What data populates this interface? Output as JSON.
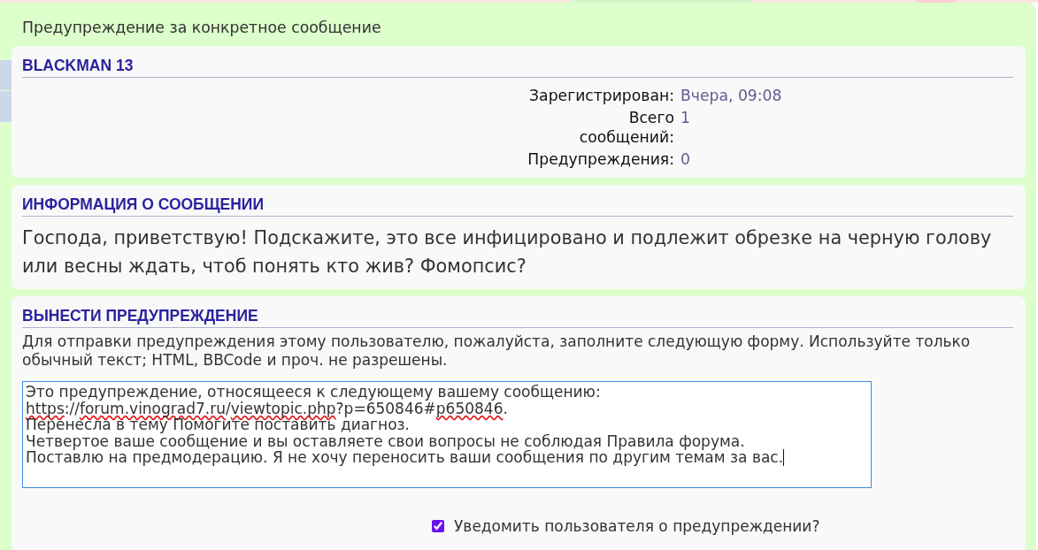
{
  "page": {
    "title": "Предупреждение за конкретное сообщение"
  },
  "user_card": {
    "heading": "BLACKMAN 13",
    "fields": [
      {
        "label": "Зарегистрирован:",
        "value": "Вчера, 09:08"
      },
      {
        "label": "Всего сообщений:",
        "value": "1"
      },
      {
        "label": "Предупреждения:",
        "value": "0"
      }
    ]
  },
  "post_card": {
    "heading": "ИНФОРМАЦИЯ О СООБЩЕНИИ",
    "text": "Господа, приветствую! Подскажите, это все инфицировано и подлежит обрезке на черную голову или весны ждать, чтоб понять кто жив? Фомопсис?"
  },
  "warning_form": {
    "heading": "ВЫНЕСТИ ПРЕДУПРЕЖДЕНИЕ",
    "instructions": "Для отправки предупреждения этому пользователю, пожалуйста, заполните следующую форму. Используйте только обычный текст; HTML, BBCode и проч. не разрешены.",
    "message": {
      "focused": true,
      "lines": [
        [
          {
            "text": "Это предупреждение, относящееся к следующему вашему сообщению:",
            "misspelled": false
          }
        ],
        [
          {
            "text": "https",
            "misspelled": true
          },
          {
            "text": "://",
            "misspelled": false
          },
          {
            "text": "forum.vinograd7.ru",
            "misspelled": true
          },
          {
            "text": "/",
            "misspelled": false
          },
          {
            "text": "viewtopic.php",
            "misspelled": true
          },
          {
            "text": "?p=650846#",
            "misspelled": false
          },
          {
            "text": "p650846",
            "misspelled": true
          },
          {
            "text": ".",
            "misspelled": false
          }
        ],
        [
          {
            "text": "Перенесла в тему Помогите поставить диагноз.",
            "misspelled": false
          }
        ],
        [
          {
            "text": "Четвертое ваше сообщение и вы оставляете свои вопросы не соблюдая Правила форума.",
            "misspelled": false
          }
        ],
        [
          {
            "text": "Поставлю на предмодерацию. Я не хочу переносить ваши сообщения по другим темам за вас.",
            "misspelled": false
          }
        ]
      ]
    },
    "notify": {
      "label": "Уведомить пользователя о предупреждении?",
      "checked": true
    }
  }
}
